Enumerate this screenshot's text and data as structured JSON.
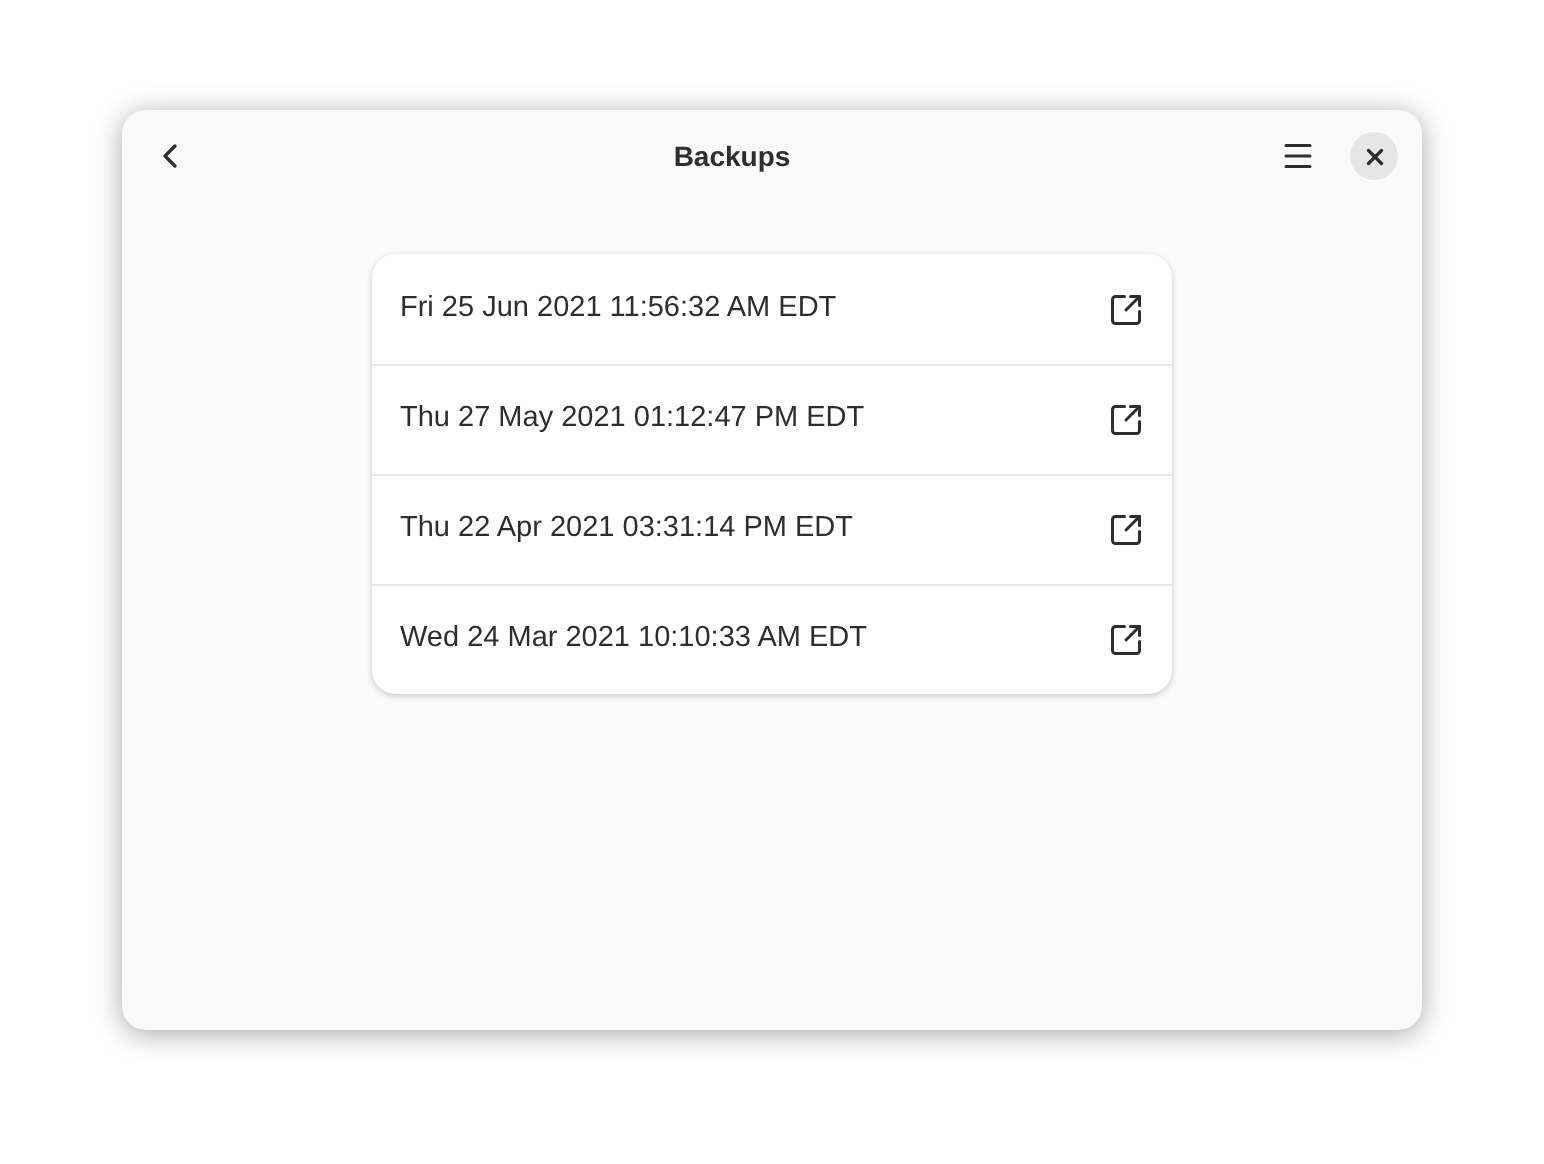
{
  "window": {
    "title": "Backups"
  },
  "backups": [
    {
      "label": "Fri 25 Jun 2021 11:56:32 AM EDT"
    },
    {
      "label": "Thu 27 May 2021 01:12:47 PM EDT"
    },
    {
      "label": "Thu 22 Apr 2021 03:31:14 PM EDT"
    },
    {
      "label": "Wed 24 Mar 2021 10:10:33 AM EDT"
    }
  ]
}
